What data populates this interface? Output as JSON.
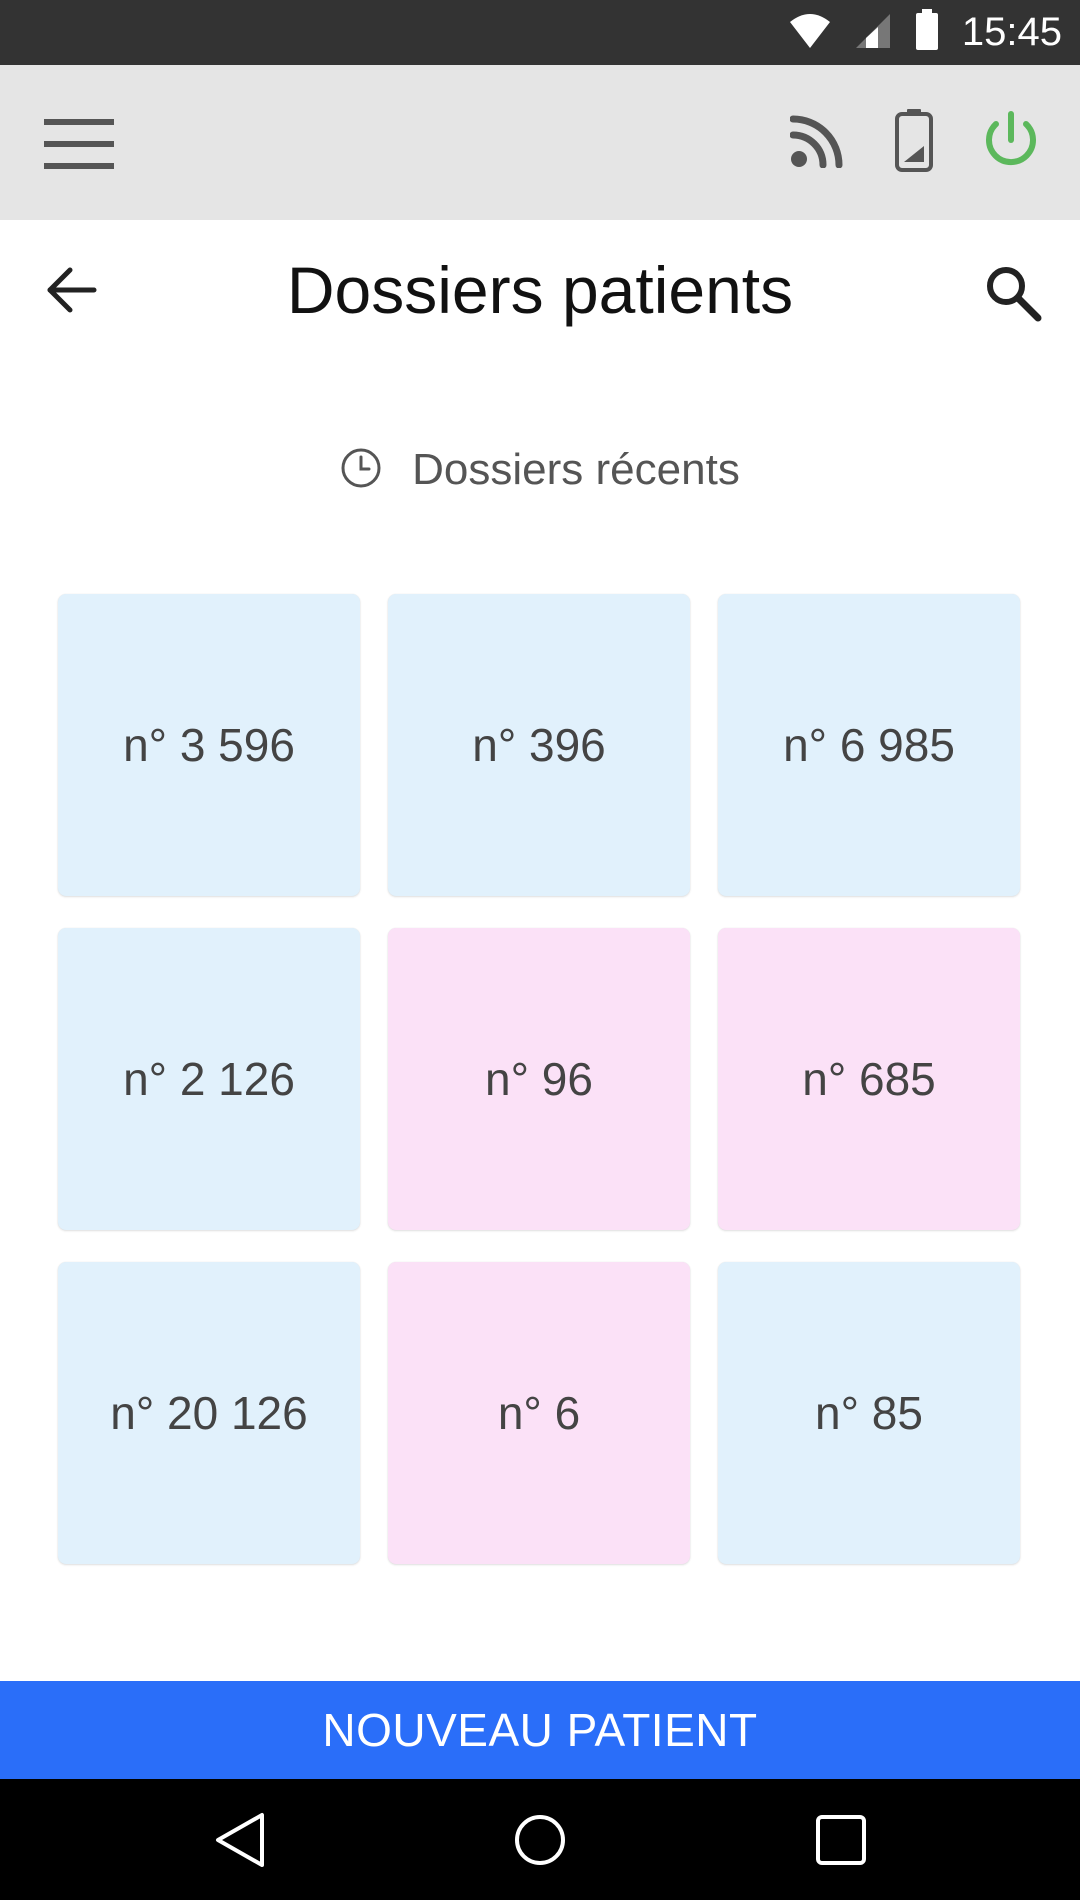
{
  "status_bar": {
    "time": "15:45",
    "icons": [
      "wifi-icon",
      "cell-signal-icon",
      "battery-icon"
    ]
  },
  "toolbar": {
    "menu_icon": "hamburger-menu-icon",
    "right_icons": [
      "rss-feed-icon",
      "device-battery-icon",
      "power-icon"
    ],
    "power_color": "#5cb85c"
  },
  "header": {
    "title": "Dossiers patients",
    "back_icon": "arrow-back-icon",
    "search_icon": "search-icon"
  },
  "recent": {
    "icon": "clock-icon",
    "label": "Dossiers récents"
  },
  "tiles": [
    {
      "label": "n° 3 596",
      "color": "blue"
    },
    {
      "label": "n° 396",
      "color": "blue"
    },
    {
      "label": "n° 6 985",
      "color": "blue"
    },
    {
      "label": "n° 2 126",
      "color": "blue"
    },
    {
      "label": "n° 96",
      "color": "pink"
    },
    {
      "label": "n° 685",
      "color": "pink"
    },
    {
      "label": "n° 20 126",
      "color": "blue"
    },
    {
      "label": "n° 6",
      "color": "pink"
    },
    {
      "label": "n° 85",
      "color": "blue"
    }
  ],
  "colors": {
    "tile_blue": "#e1f1fc",
    "tile_pink": "#fbe1f7",
    "primary_button": "#2a6ef9",
    "toolbar_bg": "#e5e5e5",
    "status_bar_bg": "#333333"
  },
  "action": {
    "new_patient_label": "NOUVEAU PATIENT"
  },
  "nav_bar": {
    "buttons": [
      "nav-back-icon",
      "nav-home-icon",
      "nav-recents-icon"
    ]
  }
}
